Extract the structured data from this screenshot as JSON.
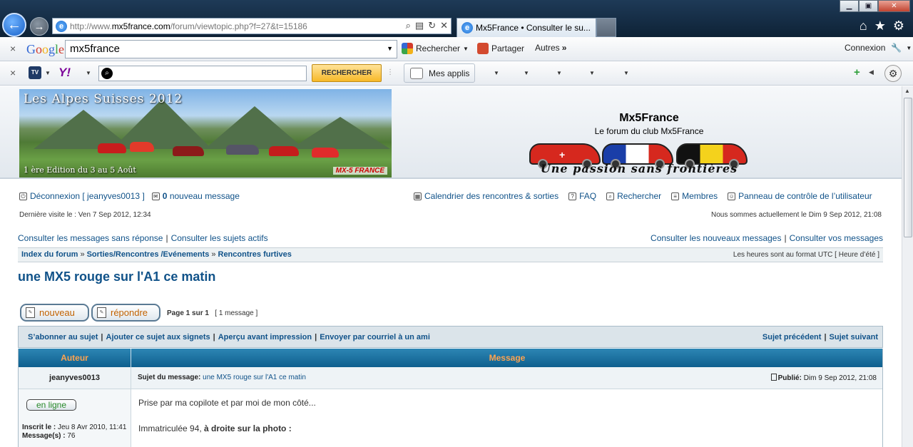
{
  "browser": {
    "url_prefix": "http://www.",
    "url_domain": "mx5france.com",
    "url_path": "/forum/viewtopic.php?f=27&t=15186",
    "tab_title": "Mx5France • Consulter le su...",
    "google_toolbar": {
      "search_value": "mx5france",
      "rechercher": "Rechercher",
      "partager": "Partager",
      "autres": "Autres",
      "connexion": "Connexion"
    },
    "yahoo_toolbar": {
      "search_button": "RECHERCHER",
      "mes_applis": "Mes applis"
    }
  },
  "header": {
    "banner_title": "Les Alpes Suisses 2012",
    "banner_subtitle": "1 ère Edition du 3 au 5 Août",
    "banner_logo": "MX-5 FRANCE",
    "site_title": "Mx5France",
    "site_description": "Le forum du club Mx5France",
    "slogan": "Une passion sans frontières"
  },
  "userbar": {
    "logout": "Déconnexion [ jeanyves0013 ]",
    "new_message_count": "0",
    "new_message_label": "nouveau message",
    "calendar": "Calendrier des rencontres & sorties",
    "faq": "FAQ",
    "search": "Rechercher",
    "members": "Membres",
    "control_panel": "Panneau de contrôle de l’utilisateur",
    "last_visit": "Dernière visite le : Ven 7 Sep 2012, 12:34",
    "current_time": "Nous sommes actuellement le Dim 9 Sep 2012, 21:08"
  },
  "quicklinks": {
    "unanswered": "Consulter les messages sans réponse",
    "active": "Consulter les sujets actifs",
    "new_posts": "Consulter les nouveaux messages",
    "your_posts": "Consulter vos messages"
  },
  "breadcrumbs": {
    "items": [
      "Index du forum",
      "Sorties/Rencontres /Evénements",
      "Rencontres furtives"
    ],
    "timezone": "Les heures sont au format UTC [ Heure d’été ]"
  },
  "topic": {
    "title": "une MX5 rouge sur l'A1 ce matin",
    "new_button": "nouveau",
    "reply_button": "répondre",
    "page_info": "Page 1 sur 1",
    "message_count": "[ 1 message ]",
    "actions": {
      "subscribe": "S’abonner au sujet",
      "bookmark": "Ajouter ce sujet aux signets",
      "print": "Aperçu avant impression",
      "email": "Envoyer par courriel à un ami",
      "prev": "Sujet précédent",
      "next": "Sujet suivant"
    },
    "table_headers": {
      "author": "Auteur",
      "message": "Message"
    }
  },
  "post": {
    "author": "jeanyves0013",
    "subject_label": "Sujet du message:",
    "subject": "une MX5 rouge sur l'A1 ce matin",
    "published_label": "Publié:",
    "published_date": "Dim 9 Sep 2012, 21:08",
    "online_badge": "en ligne",
    "registered_label": "Inscrit le :",
    "registered_date": "Jeu 8 Avr 2010, 11:41",
    "messages_label": "Message(s) :",
    "messages_count": "76",
    "body_line1": "Prise par ma copilote et par moi de mon côté...",
    "body_line2_prefix": "Immatriculée 94,",
    "body_line2_bold": "à droite sur la photo :"
  }
}
